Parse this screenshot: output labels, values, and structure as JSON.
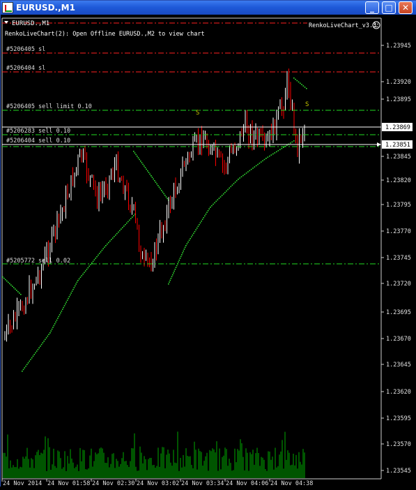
{
  "window": {
    "title": "EURUSD.,M1",
    "minimize_glyph": "_",
    "maximize_glyph": "□",
    "close_glyph": "✕"
  },
  "chart": {
    "symbol_label": "EURUSD.,M1",
    "info_text": "RenkoLiveChart(2): Open Offline EURUSD.,M2 to view chart",
    "indicator_label": "RenkoLiveChart_v3.3",
    "indicator_icon": "smiley-icon",
    "chart_type": "candlestick",
    "colors": {
      "background": "#000000",
      "candle_up": "#ffffff",
      "candle_down": "#ff0000",
      "order_sl_line": "#ff0000",
      "order_line": "#00ff00",
      "bid_line": "#ffffff",
      "ma_dots": "#32e032",
      "volume": "#00aa00"
    },
    "price_ticks": [
      "1.23945",
      "1.23920",
      "1.23895",
      "1.23845",
      "1.23820",
      "1.23795",
      "1.23770",
      "1.23745",
      "1.23720",
      "1.23695",
      "1.23670",
      "1.23645",
      "1.23620",
      "1.23595",
      "1.23570",
      "1.23545"
    ],
    "bid_price": "1.23869",
    "current_price": "1.23851",
    "time_ticks": [
      "24 Nov 2014",
      "24 Nov 01:58",
      "24 Nov 02:30",
      "24 Nov 03:02",
      "24 Nov 03:34",
      "24 Nov 04:06",
      "24 Nov 04:38"
    ],
    "order_labels": {
      "sl_1": "#5206405 sl",
      "sl_2": "#5206404 sl",
      "sell_limit": "#5206405 sell limit 0.10",
      "sell_1": "#5206283 sell 0.10",
      "sell_2": "#5206404 sell 0.10",
      "sell_3": "#5205772 sell 0.02"
    },
    "signal_marks": [
      "S",
      "S"
    ]
  }
}
